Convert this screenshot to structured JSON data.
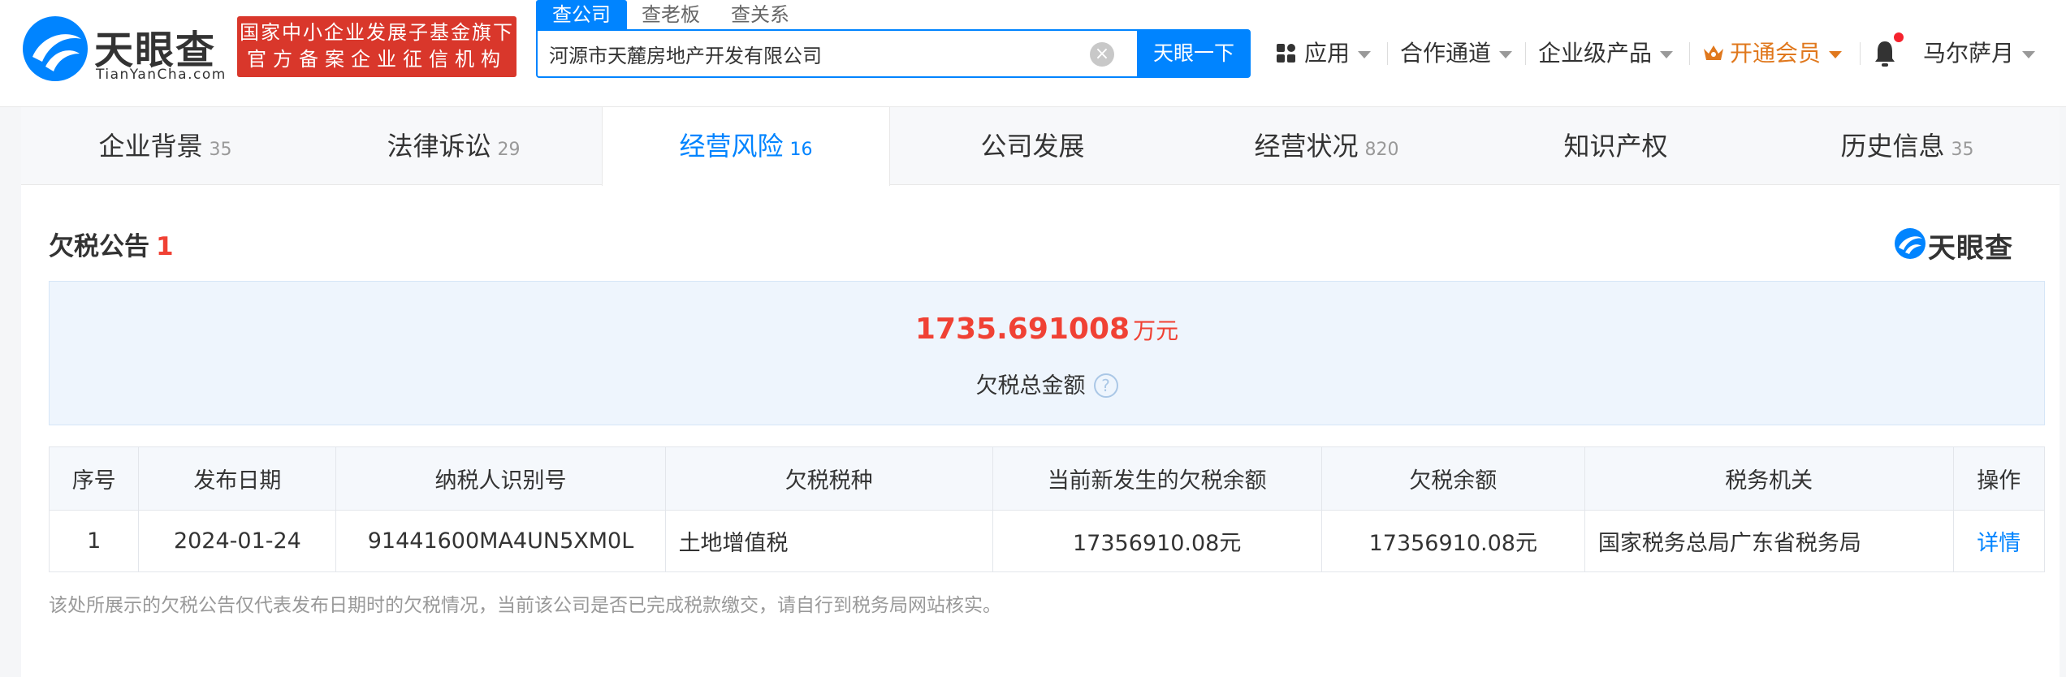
{
  "brand": {
    "name": "天眼查",
    "domain": "TianYanCha.com",
    "fund_line1": "国家中小企业发展子基金旗下",
    "fund_line2": "官方备案企业征信机构"
  },
  "search": {
    "tabs": [
      "查公司",
      "查老板",
      "查关系"
    ],
    "active_tab": 0,
    "value": "河源市天麓房地产开发有限公司",
    "button_label": "天眼一下"
  },
  "nav": {
    "apps": "应用",
    "partners": "合作通道",
    "enterprise": "企业级产品",
    "vip": "开通会员",
    "user": "马尔萨月"
  },
  "colors": {
    "accent": "#0084ff",
    "danger": "#f04134",
    "vip": "#e0781d",
    "brand_red": "#d9372b"
  },
  "tabs": [
    {
      "label": "企业背景",
      "count": "35"
    },
    {
      "label": "法律诉讼",
      "count": "29"
    },
    {
      "label": "经营风险",
      "count": "16"
    },
    {
      "label": "公司发展",
      "count": ""
    },
    {
      "label": "经营状况",
      "count": "820"
    },
    {
      "label": "知识产权",
      "count": ""
    },
    {
      "label": "历史信息",
      "count": "35"
    }
  ],
  "active_tab_index": 2,
  "section": {
    "title": "欠税公告",
    "count": "1",
    "brand_mark": "天眼查"
  },
  "summary": {
    "amount": "1735.691008",
    "unit": "万元",
    "label": "欠税总金额"
  },
  "table": {
    "headers": [
      "序号",
      "发布日期",
      "纳税人识别号",
      "欠税税种",
      "当前新发生的欠税余额",
      "欠税余额",
      "税务机关",
      "操作"
    ],
    "rows": [
      [
        "1",
        "2024-01-24",
        "91441600MA4UN5XM0L",
        "土地增值税",
        "17356910.08元",
        "17356910.08元",
        "国家税务总局广东省税务局",
        "详情"
      ]
    ]
  },
  "note": "该处所展示的欠税公告仅代表发布日期时的欠税情况，当前该公司是否已完成税款缴交，请自行到税务局网站核实。"
}
